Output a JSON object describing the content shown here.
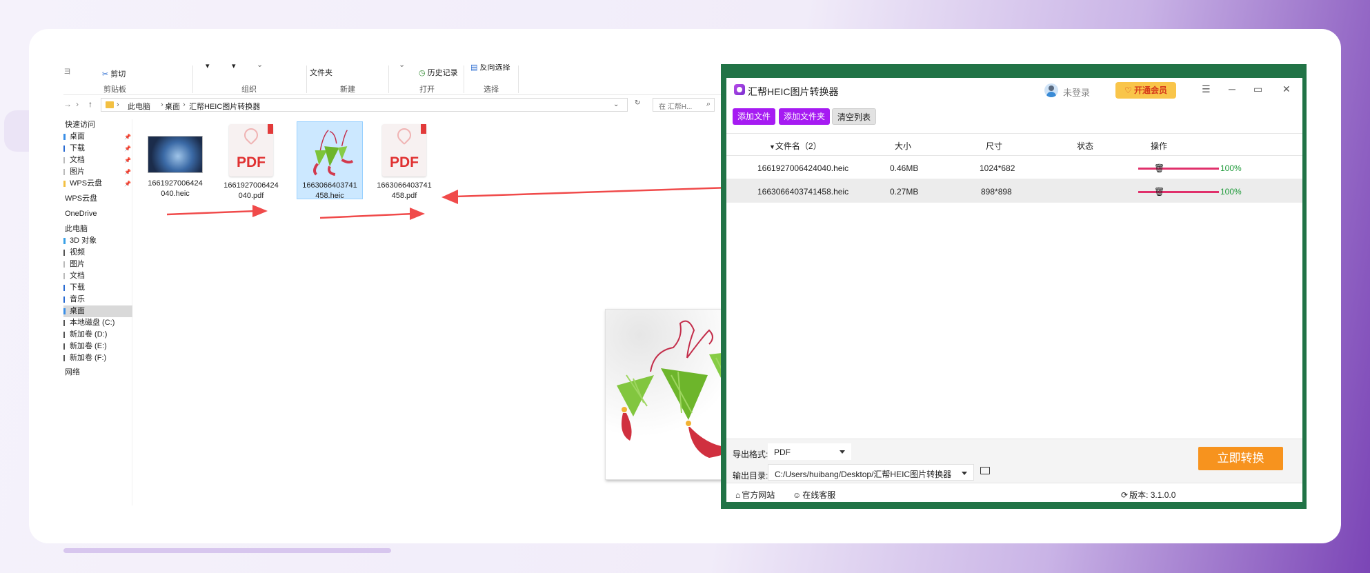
{
  "explorer": {
    "ribbon": {
      "cut": "剪切",
      "clipboard": "剪贴板",
      "organize": "组织",
      "folder": "文件夹",
      "new": "新建",
      "history": "历史记录",
      "open": "打开",
      "invert_select": "反向选择",
      "select": "选择"
    },
    "address": {
      "crumbs": [
        "此电脑",
        "桌面",
        "汇帮HEIC图片转换器"
      ],
      "search_placeholder": "在 汇帮H..."
    },
    "sidebar": [
      {
        "label": "快速访问",
        "pin": false
      },
      {
        "label": "桌面",
        "pin": true
      },
      {
        "label": "下载",
        "pin": true
      },
      {
        "label": "文档",
        "pin": true
      },
      {
        "label": "图片",
        "pin": true
      },
      {
        "label": "WPS云盘",
        "pin": true
      },
      {
        "label": "WPS云盘",
        "pin": false
      },
      {
        "label": "OneDrive",
        "pin": false
      },
      {
        "label": "此电脑",
        "pin": false
      },
      {
        "label": "3D 对象",
        "pin": false
      },
      {
        "label": "视频",
        "pin": false
      },
      {
        "label": "图片",
        "pin": false
      },
      {
        "label": "文档",
        "pin": false
      },
      {
        "label": "下载",
        "pin": false
      },
      {
        "label": "音乐",
        "pin": false
      },
      {
        "label": "桌面",
        "pin": false,
        "selected": true
      },
      {
        "label": "本地磁盘 (C:)",
        "pin": false
      },
      {
        "label": "新加卷 (D:)",
        "pin": false
      },
      {
        "label": "新加卷 (E:)",
        "pin": false
      },
      {
        "label": "新加卷 (F:)",
        "pin": false
      },
      {
        "label": "网络",
        "pin": false
      }
    ],
    "files": [
      {
        "line1": "1661927006424",
        "line2": "040.heic",
        "kind": "photo"
      },
      {
        "line1": "1661927006424",
        "line2": "040.pdf",
        "kind": "pdf"
      },
      {
        "line1": "1663066403741",
        "line2": "458.heic",
        "kind": "zongzi",
        "selected": true
      },
      {
        "line1": "1663066403741",
        "line2": "458.pdf",
        "kind": "pdf"
      }
    ],
    "pdf_label": "PDF"
  },
  "converter": {
    "title": "汇帮HEIC图片转换器",
    "login": "未登录",
    "vip": "开通会员",
    "buttons": {
      "add_file": "添加文件",
      "add_folder": "添加文件夹",
      "clear": "清空列表"
    },
    "columns": {
      "name": "文件名（2）",
      "size": "大小",
      "dimension": "尺寸",
      "status": "状态",
      "action": "操作"
    },
    "rows": [
      {
        "name": "1661927006424040.heic",
        "size": "0.46MB",
        "dimension": "1024*682",
        "progress": 1.0,
        "pct": "100%"
      },
      {
        "name": "1663066403741458.heic",
        "size": "0.27MB",
        "dimension": "898*898",
        "progress": 1.0,
        "pct": "100%"
      }
    ],
    "export_format_label": "导出格式:",
    "export_format_value": "PDF",
    "output_dir_label": "输出目录:",
    "output_dir_value": "C:/Users/huibang/Desktop/汇帮HEIC图片转换器",
    "convert": "立即转换",
    "footer": {
      "website": "官方网站",
      "service": "在线客服",
      "version": "版本:  3.1.0.0"
    }
  },
  "colors": {
    "accent_purple": "#a61bf2",
    "frame_green": "#217346",
    "convert_orange": "#f7931e",
    "progress_pink": "#e0306b",
    "annotation_red": "#f04a4a"
  }
}
